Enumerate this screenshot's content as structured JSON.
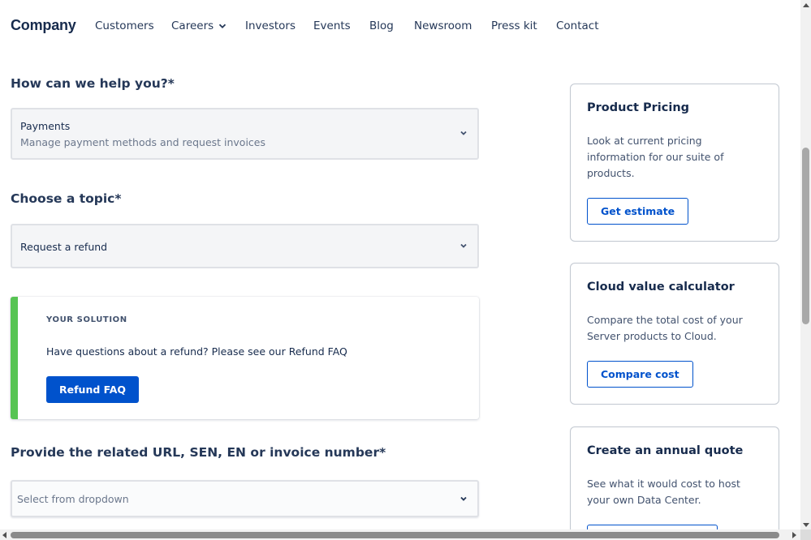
{
  "header": {
    "logo": "Company",
    "nav": [
      {
        "label": "Customers"
      },
      {
        "label": "Careers"
      },
      {
        "label": "Investors"
      },
      {
        "label": "Events"
      },
      {
        "label": "Blog"
      },
      {
        "label": "Newsroom"
      },
      {
        "label": "Press kit"
      },
      {
        "label": "Contact"
      }
    ]
  },
  "form": {
    "help_label": "How can we help you?*",
    "help_select": {
      "title": "Payments",
      "subtitle": "Manage payment methods and request invoices"
    },
    "topic_label": "Choose a topic*",
    "topic_select": {
      "value": "Request a refund"
    },
    "solution": {
      "kicker": "YOUR SOLUTION",
      "text": "Have questions about a refund? Please see our Refund FAQ",
      "button": "Refund FAQ"
    },
    "url_label": "Provide the related URL, SEN, EN or invoice number*",
    "url_select": {
      "placeholder": "Select from dropdown"
    }
  },
  "cards": [
    {
      "title": "Product Pricing",
      "text": "Look at current pricing information for our suite of products.",
      "button": "Get estimate"
    },
    {
      "title": "Cloud value calculator",
      "text": "Compare the total cost of your Server products to Cloud.",
      "button": "Compare cost"
    },
    {
      "title": "Create an annual quote",
      "text": "See what it would cost to host your own Data Center.",
      "button": ""
    }
  ],
  "colors": {
    "primary": "#0052cc",
    "solution_accent": "#57c453",
    "text": "#172b4d"
  }
}
